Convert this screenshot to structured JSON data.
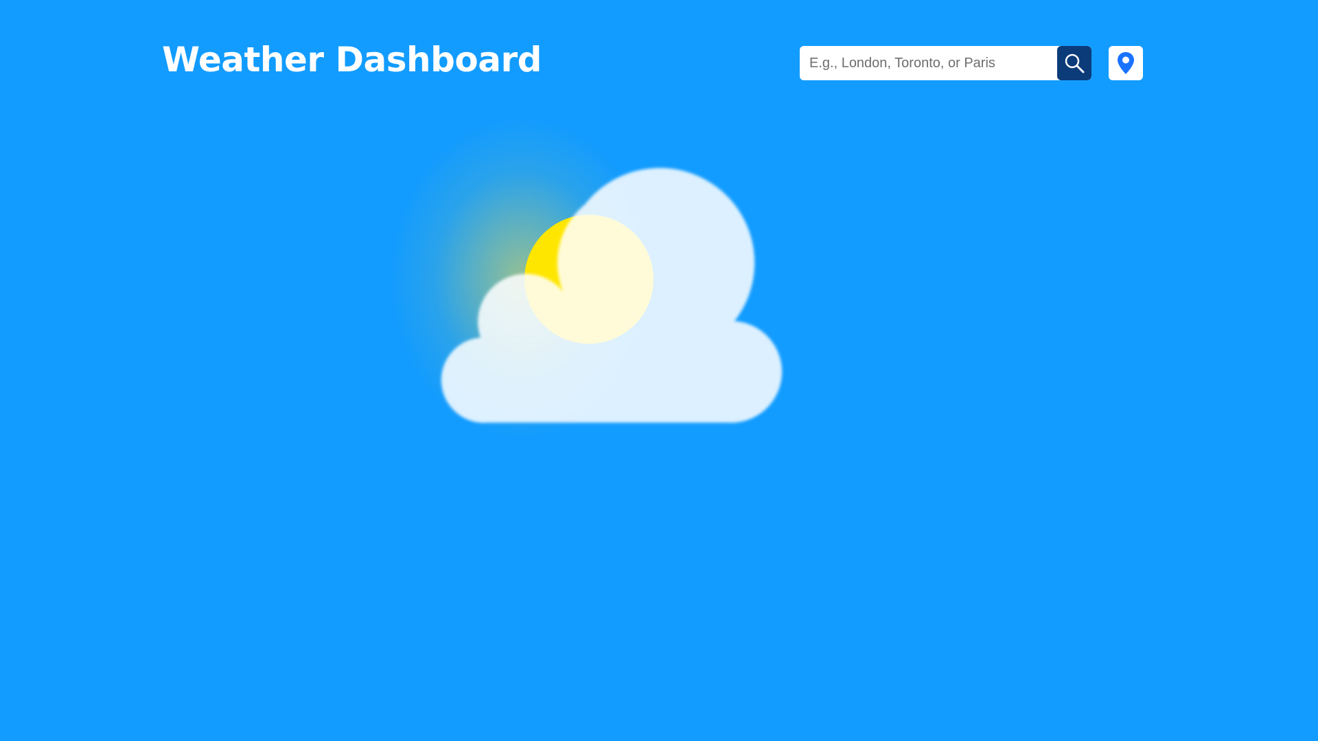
{
  "header": {
    "title": "Weather Dashboard"
  },
  "search": {
    "placeholder": "E.g., London, Toronto, or Paris",
    "value": "",
    "button_icon": "search-icon"
  },
  "location": {
    "button_icon": "location-pin-icon"
  },
  "illustration": {
    "icon": "partly-cloudy-icon"
  },
  "colors": {
    "background": "#129cff",
    "search_button": "#0c3b7a",
    "sun": "#ffe600",
    "pin": "#1a73ff"
  }
}
